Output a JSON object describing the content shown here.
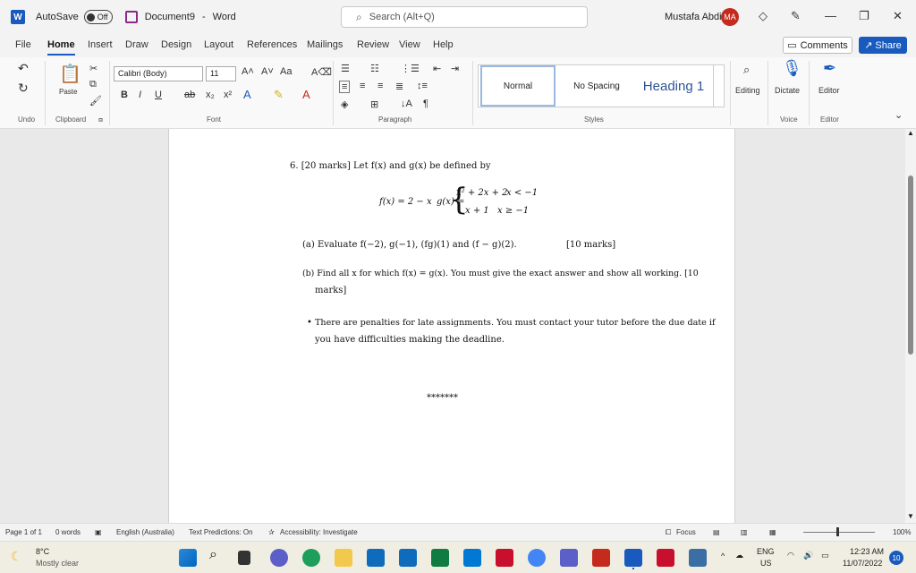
{
  "titlebar": {
    "autosave_label": "AutoSave",
    "autosave_state": "Off",
    "document_name": "Document9",
    "separator": "-",
    "app_name": "Word",
    "search_placeholder": "Search (Alt+Q)",
    "user_name": "Mustafa Abdi",
    "user_initials": "MA"
  },
  "menu": {
    "tabs": [
      "File",
      "Home",
      "Insert",
      "Draw",
      "Design",
      "Layout",
      "References",
      "Mailings",
      "Review",
      "View",
      "Help"
    ],
    "active_tab": "Home",
    "comments_label": "Comments",
    "share_label": "Share"
  },
  "ribbon": {
    "undo_label": "Undo",
    "clipboard_label": "Clipboard",
    "paste_label": "Paste",
    "font_label": "Font",
    "font_name": "Calibri (Body)",
    "font_size": "11",
    "paragraph_label": "Paragraph",
    "styles_label": "Styles",
    "style_normal": "Normal",
    "style_nospacing": "No Spacing",
    "style_heading1": "Heading 1",
    "editing_label": "Editing",
    "dictate_label": "Dictate",
    "editor_label": "Editor",
    "voice_label": "Voice",
    "editor_group_label": "Editor"
  },
  "document": {
    "q_heading": "6. [20 marks] Let f(x) and g(x) be defined by",
    "f_def": "f(x) = 2 − x",
    "g_lhs": "g(x) =",
    "g_case1_expr": "x² + 2x + 2",
    "g_case1_cond": "x < −1",
    "g_case2_expr": "x + 1",
    "g_case2_cond": "x ≥ −1",
    "part_a": "(a) Evaluate f(−2), g(−1), (fg)(1) and (f − g)(2).",
    "part_a_marks": "[10 marks]",
    "part_b_line1": "(b) Find all x for which f(x) = g(x). You must give the exact answer and show all working. [10",
    "part_b_line2": "marks]",
    "bullet_line1": "There are penalties for late assignments. You must contact your tutor before the due date if",
    "bullet_line2": "you have difficulties making the deadline.",
    "end_marker": "*******"
  },
  "statusbar": {
    "page": "Page 1 of 1",
    "words": "0 words",
    "language": "English (Australia)",
    "text_predictions": "Text Predictions: On",
    "accessibility": "Accessibility: Investigate",
    "focus": "Focus",
    "zoom": "100%"
  },
  "taskbar": {
    "temperature": "8°C",
    "weather": "Mostly clear",
    "lang_top": "ENG",
    "lang_bottom": "US",
    "time": "12:23 AM",
    "date": "11/07/2022",
    "notifications": "10"
  },
  "colors": {
    "word_blue": "#185abd",
    "avatar_red": "#c42b1c",
    "heading_blue": "#2f5496"
  }
}
